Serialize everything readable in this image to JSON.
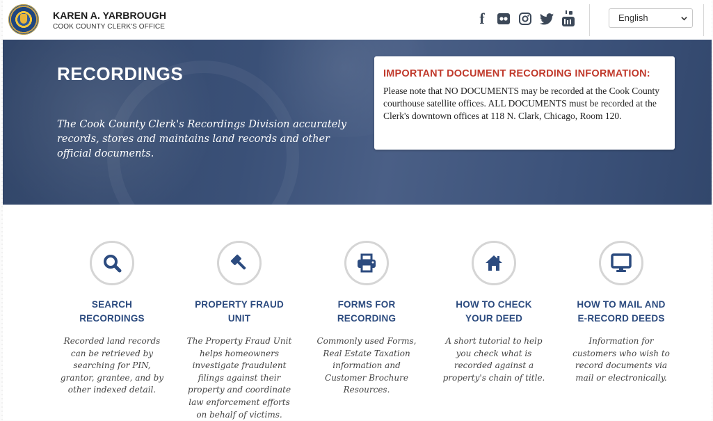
{
  "header": {
    "name": "KAREN A. YARBROUGH",
    "office": "COOK COUNTY CLERK'S OFFICE",
    "social": [
      {
        "icon": "facebook-icon",
        "glyph": "f"
      },
      {
        "icon": "flickr-icon",
        "glyph": ""
      },
      {
        "icon": "instagram-icon",
        "glyph": ""
      },
      {
        "icon": "twitter-icon",
        "glyph": ""
      },
      {
        "icon": "youtube-icon",
        "glyph": ""
      }
    ],
    "language": {
      "selected": "English"
    }
  },
  "hero": {
    "title": "RECORDINGS",
    "description": "The Cook County Clerk's Recordings Division accurately records, stores and maintains land records and other official documents.",
    "notice": {
      "title": "IMPORTANT DOCUMENT RECORDING INFORMATION:",
      "text": "Please note that NO DOCUMENTS may be recorded at the Cook County courthouse satellite offices. ALL DOCUMENTS must be recorded at the Clerk's downtown offices at 118 N. Clark, Chicago, Room 120."
    }
  },
  "services": [
    {
      "icon": "search-icon",
      "title_1": "SEARCH",
      "title_2": "RECORDINGS",
      "description": "Recorded land records can be retrieved by searching for PIN, grantor, grantee, and by other indexed detail."
    },
    {
      "icon": "gavel-icon",
      "title_1": "PROPERTY FRAUD",
      "title_2": "UNIT",
      "description": "The Property Fraud Unit helps homeowners investigate fraudulent filings against their property and coordinate law enforcement efforts on behalf of victims."
    },
    {
      "icon": "printer-icon",
      "title_1": "FORMS FOR",
      "title_2": "RECORDING",
      "description": "Commonly used Forms, Real Estate Taxation information and Customer Brochure Resources."
    },
    {
      "icon": "home-icon",
      "title_1": "HOW TO CHECK",
      "title_2": "YOUR DEED",
      "description": "A short tutorial to help you check what is recorded against a property's chain of title."
    },
    {
      "icon": "monitor-icon",
      "title_1": "HOW TO MAIL AND",
      "title_2": "E-RECORD DEEDS",
      "description": "Information for customers who wish to record documents via mail or electronically."
    }
  ],
  "colors": {
    "accent": "#2c4b7f",
    "alert": "#c0392b",
    "hero": "#3a5077"
  }
}
